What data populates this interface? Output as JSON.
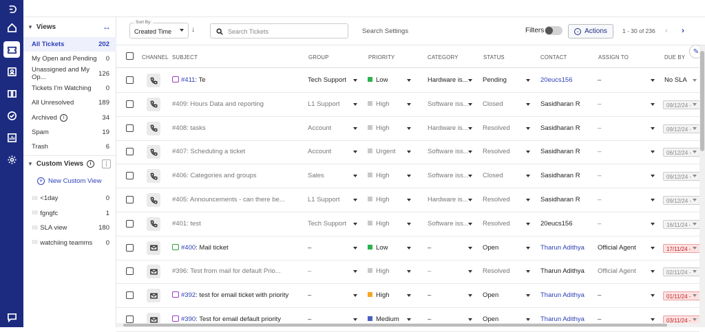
{
  "rail_icons": [
    {
      "name": "logo-icon"
    },
    {
      "name": "home-icon"
    },
    {
      "name": "tickets-icon"
    },
    {
      "name": "contacts-icon"
    },
    {
      "name": "knowledge-base-icon"
    },
    {
      "name": "tasks-icon"
    },
    {
      "name": "reports-icon"
    },
    {
      "name": "settings-icon"
    },
    {
      "name": "chat-icon"
    }
  ],
  "sidebar": {
    "views_title": "Views",
    "views": [
      {
        "label": "All Tickets",
        "count": "202"
      },
      {
        "label": "My Open and Pending",
        "count": "0"
      },
      {
        "label": "Unassigned and My Op...",
        "count": "126"
      },
      {
        "label": "Tickets I'm Watching",
        "count": "0"
      },
      {
        "label": "All Unresolved",
        "count": "189"
      },
      {
        "label": "Archived",
        "count": "34"
      },
      {
        "label": "Spam",
        "count": "19"
      },
      {
        "label": "Trash",
        "count": "6"
      }
    ],
    "custom_title": "Custom Views",
    "new_custom": "New Custom View",
    "custom_views": [
      {
        "label": "<1day",
        "count": "0"
      },
      {
        "label": "fgngfc",
        "count": "1"
      },
      {
        "label": "SLA view",
        "count": "180"
      },
      {
        "label": "watchiing teamms",
        "count": "0"
      }
    ]
  },
  "toolbar": {
    "sort_label": "Sort By:",
    "sort_value": "Created Time",
    "search_placeholder": "Search Tickets",
    "search_settings": "Search Settings",
    "filters": "Filters",
    "actions": "Actions",
    "pagination": "1 - 30 of 236"
  },
  "columns": {
    "channel": "CHANNEL",
    "subject": "SUBJECT",
    "group": "GROUP",
    "priority": "PRIORITY",
    "category": "CATEGORY",
    "status": "STATUS",
    "contact": "CONTACT",
    "assign": "ASSIGN TO",
    "due": "DUE BY"
  },
  "rows": [
    {
      "channel": "phone",
      "tag": "purple",
      "id": "#411",
      "subject": ": Te",
      "group": "Tech Support",
      "priority": "Low",
      "pcolor": "#2bb24c",
      "category": "Hardware is...",
      "status": "Pending",
      "contact": "20eucs156",
      "clink": true,
      "assign": "–",
      "due": "No SLA",
      "due_kind": "text",
      "muted": false
    },
    {
      "channel": "phone",
      "tag": "",
      "id": "",
      "subject": "#409: Hours Data and reporting",
      "group": "L1 Support",
      "priority": "High",
      "pcolor": "#c8c8c8",
      "category": "Software iss...",
      "status": "Closed",
      "contact": "Sasidharan R",
      "clink": false,
      "assign": "–",
      "due": "09/12/24 -",
      "due_kind": "gray",
      "muted": true
    },
    {
      "channel": "phone",
      "tag": "",
      "id": "",
      "subject": "#408: tasks",
      "group": "Account",
      "priority": "High",
      "pcolor": "#c8c8c8",
      "category": "Hardware is...",
      "status": "Resolved",
      "contact": "Sasidharan R",
      "clink": false,
      "assign": "–",
      "due": "09/12/24 -",
      "due_kind": "gray",
      "muted": true
    },
    {
      "channel": "phone",
      "tag": "",
      "id": "",
      "subject": "#407: Scheduling a ticket",
      "group": "Account",
      "priority": "Urgent",
      "pcolor": "#c8c8c8",
      "category": "Software iss...",
      "status": "Resolved",
      "contact": "Sasidharan R",
      "clink": false,
      "assign": "–",
      "due": "06/12/24 -",
      "due_kind": "gray",
      "muted": true
    },
    {
      "channel": "phone",
      "tag": "",
      "id": "",
      "subject": "#406: Categories and groups",
      "group": "Sales",
      "priority": "High",
      "pcolor": "#c8c8c8",
      "category": "Software iss...",
      "status": "Closed",
      "contact": "Sasidharan R",
      "clink": false,
      "assign": "–",
      "due": "09/12/24 -",
      "due_kind": "gray",
      "muted": true
    },
    {
      "channel": "phone",
      "tag": "",
      "id": "",
      "subject": "#405: Announcements - can there be...",
      "group": "L1 Support",
      "priority": "High",
      "pcolor": "#c8c8c8",
      "category": "Hardware is...",
      "status": "Resolved",
      "contact": "Sasidharan R",
      "clink": false,
      "assign": "–",
      "due": "09/12/24 -",
      "due_kind": "gray",
      "muted": true
    },
    {
      "channel": "phone",
      "tag": "",
      "id": "",
      "subject": "#401: test",
      "group": "Tech Support",
      "priority": "High",
      "pcolor": "#c8c8c8",
      "category": "Software iss...",
      "status": "Resolved",
      "contact": "20eucs156",
      "clink": false,
      "assign": "–",
      "due": "16/11/24 -",
      "due_kind": "gray",
      "muted": true
    },
    {
      "channel": "mail",
      "tag": "green",
      "id": "#400",
      "subject": ": Mail ticket",
      "group": "–",
      "priority": "Low",
      "pcolor": "#2bb24c",
      "category": "–",
      "status": "Open",
      "contact": "Tharun Adithya",
      "clink": true,
      "assign": "Official Agent",
      "due": "17/11/24 -",
      "due_kind": "red",
      "muted": false
    },
    {
      "channel": "mail",
      "tag": "",
      "id": "",
      "subject": "#396: Test from mail for default Prio...",
      "group": "–",
      "priority": "High",
      "pcolor": "#c8c8c8",
      "category": "–",
      "status": "Resolved",
      "contact": "Tharun Adithya",
      "clink": false,
      "assign": "Official Agent",
      "due": "02/11/24 -",
      "due_kind": "gray",
      "muted": true
    },
    {
      "channel": "mail",
      "tag": "purple",
      "id": "#392",
      "subject": ": test for email ticket with priority",
      "group": "–",
      "priority": "High",
      "pcolor": "#f5a623",
      "category": "–",
      "status": "Open",
      "contact": "Tharun Adithya",
      "clink": true,
      "assign": "–",
      "due": "01/11/24 -",
      "due_kind": "red",
      "muted": false
    },
    {
      "channel": "mail",
      "tag": "purple",
      "id": "#390",
      "subject": ": Test for email default priority",
      "group": "–",
      "priority": "Medium",
      "pcolor": "#4a5fc1",
      "category": "–",
      "status": "Open",
      "contact": "Tharun Adithya",
      "clink": true,
      "assign": "–",
      "due": "03/11/24 -",
      "due_kind": "red",
      "muted": false
    }
  ],
  "colors": {
    "rail": "#1c2b80",
    "accent": "#2b3fb5",
    "overdue": "#fde1e1"
  }
}
